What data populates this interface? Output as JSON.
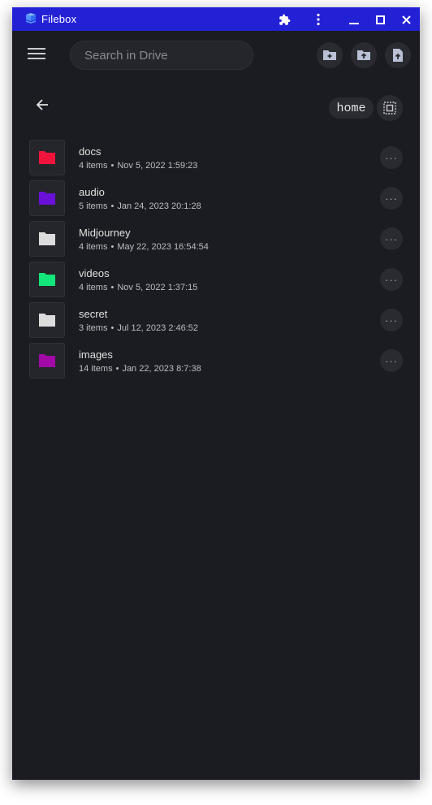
{
  "window": {
    "title": "Filebox",
    "titlebar_color": "#2321d6",
    "background_color": "#1b1c21"
  },
  "titlebar_icons": [
    "app-logo-icon",
    "puzzle-extension-icon",
    "more-vertical-icon",
    "minimize-icon",
    "maximize-icon",
    "close-icon"
  ],
  "toolbar": {
    "menu_icon": "hamburger-menu-icon",
    "search_placeholder": "Search in Drive",
    "search_value": "",
    "actions": [
      {
        "name": "new-folder-button",
        "icon": "create-new-folder-icon"
      },
      {
        "name": "upload-folder-button",
        "icon": "folder-upload-icon"
      },
      {
        "name": "upload-file-button",
        "icon": "file-upload-icon"
      }
    ]
  },
  "nav": {
    "back_icon": "arrow-left-icon",
    "current_path": "home",
    "select_icon": "select-all-icon"
  },
  "files": [
    {
      "name": "docs",
      "items": "4 items",
      "separator": "•",
      "modified": "Nov 5, 2022 1:59:23",
      "folder_color": "#f0143c"
    },
    {
      "name": "audio",
      "items": "5 items",
      "separator": "•",
      "modified": "Jan 24, 2023 20:1:28",
      "folder_color": "#6a10d8"
    },
    {
      "name": "Midjourney",
      "items": "4 items",
      "separator": "•",
      "modified": "May 22, 2023 16:54:54",
      "folder_color": "#dcdcdc"
    },
    {
      "name": "videos",
      "items": "4 items",
      "separator": "•",
      "modified": "Nov 5, 2022 1:37:15",
      "folder_color": "#12e57a"
    },
    {
      "name": "secret",
      "items": "3 items",
      "separator": "•",
      "modified": "Jul 12, 2023 2:46:52",
      "folder_color": "#dcdcdc"
    },
    {
      "name": "images",
      "items": "14 items",
      "separator": "•",
      "modified": "Jan 22, 2023 8:7:38",
      "folder_color": "#a20aa6"
    }
  ],
  "row_more_label": "···"
}
